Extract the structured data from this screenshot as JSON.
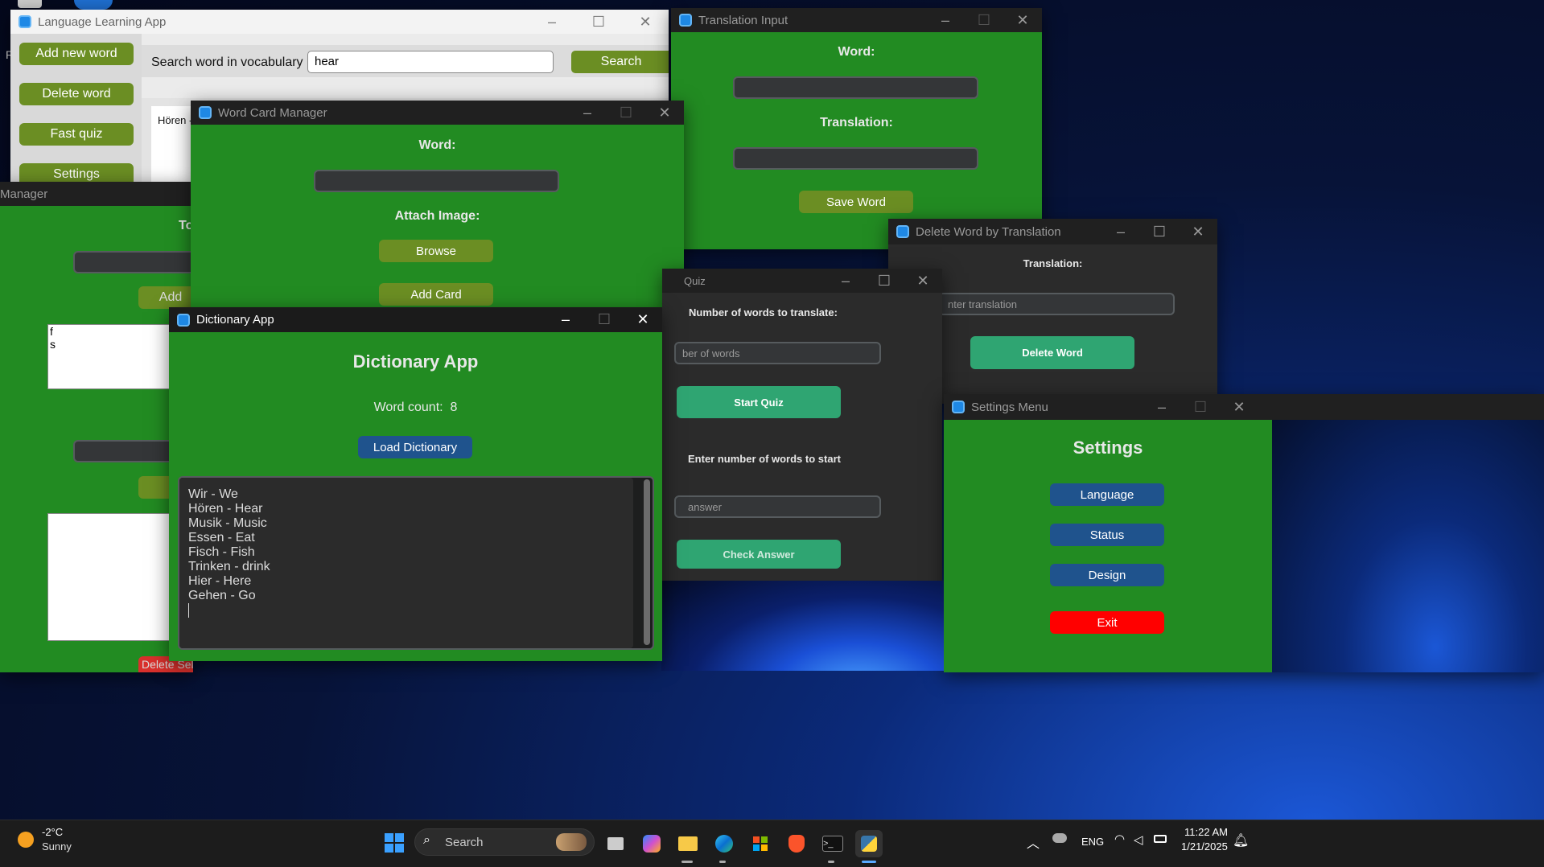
{
  "desktop": {
    "edge_letter": "R"
  },
  "lang_app": {
    "title": "Language Learning App",
    "sidebar": [
      "Add new word",
      "Delete word",
      "Fast quiz",
      "Settings"
    ],
    "search_label": "Search word in vocabulary",
    "search_value": "hear",
    "search_button": "Search",
    "result_text": "Hören -"
  },
  "translation_input": {
    "title": "Translation Input",
    "word_label": "Word:",
    "translation_label": "Translation:",
    "save_button": "Save Word"
  },
  "card_manager_back": {
    "title": "Manager",
    "label_partial": "To",
    "add_partial": "Add",
    "list_items": [
      "f",
      "s"
    ],
    "delete_button": "Delete Selected Word"
  },
  "word_card_manager": {
    "title": "Word Card Manager",
    "word_label": "Word:",
    "attach_label": "Attach Image:",
    "browse_button": "Browse",
    "add_card_button": "Add Card"
  },
  "delete_by_translation": {
    "title": "Delete Word by Translation",
    "translation_label": "Translation:",
    "placeholder": "nter translation",
    "delete_button": "Delete Word"
  },
  "quiz": {
    "title": "Quiz",
    "num_label": "Number of words to translate:",
    "num_placeholder": "ber of words",
    "start_button": "Start Quiz",
    "enter_label": "Enter number of words to start",
    "answer_placeholder": "answer",
    "check_button": "Check Answer"
  },
  "settings": {
    "title": "Settings Menu",
    "heading": "Settings",
    "buttons": [
      "Language",
      "Status",
      "Design"
    ],
    "exit": "Exit"
  },
  "dictionary": {
    "title": "Dictionary App",
    "heading": "Dictionary App",
    "word_count_label": "Word count:",
    "word_count": "8",
    "load_button": "Load Dictionary",
    "entries": [
      "Wir - We",
      "Hören - Hear",
      "Musik - Music",
      "Essen - Eat",
      "Fisch - Fish",
      "Trinken - drink",
      "Hier - Here",
      "Gehen - Go"
    ]
  },
  "taskbar": {
    "weather_temp": "-2°C",
    "weather_desc": "Sunny",
    "search": "Search",
    "language": "ENG",
    "time": "11:22 AM",
    "date": "1/21/2025"
  }
}
